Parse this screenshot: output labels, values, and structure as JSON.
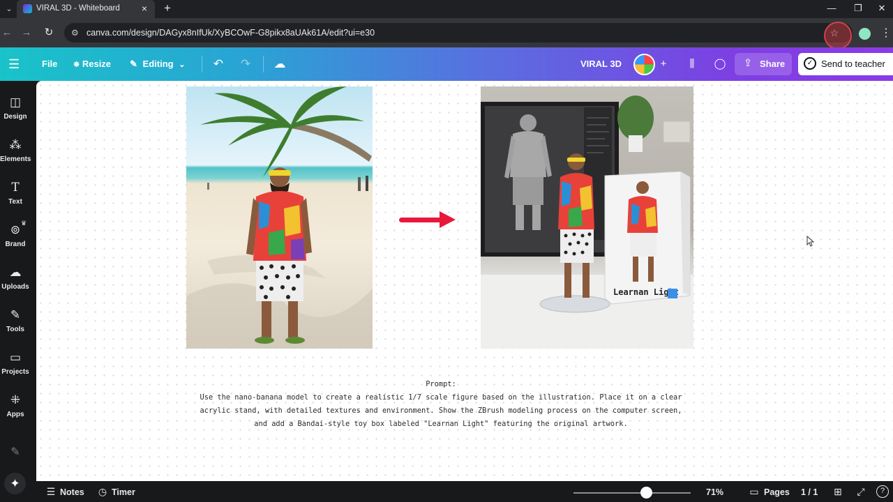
{
  "browser": {
    "tab_title": "VIRAL 3D - Whiteboard",
    "url": "canva.com/design/DAGyx8nIfUk/XyBCOwF-G8pikx8aUAk61A/edit?ui=e30"
  },
  "header": {
    "file": "File",
    "resize": "Resize",
    "editing": "Editing",
    "design_title": "VIRAL 3D",
    "share": "Share",
    "send_to_teacher": "Send to teacher"
  },
  "sidebar": {
    "items": [
      {
        "label": "Design",
        "icon": "design-icon"
      },
      {
        "label": "Elements",
        "icon": "elements-icon"
      },
      {
        "label": "Text",
        "icon": "text-icon"
      },
      {
        "label": "Brand",
        "icon": "brand-icon"
      },
      {
        "label": "Uploads",
        "icon": "uploads-icon"
      },
      {
        "label": "Tools",
        "icon": "tools-icon"
      },
      {
        "label": "Projects",
        "icon": "projects-icon"
      },
      {
        "label": "Apps",
        "icon": "apps-icon"
      }
    ]
  },
  "canvas": {
    "figure_box_label": "Learnan Light",
    "prompt_title": "Prompt:",
    "prompt_body": "Use the nano-banana model to create a realistic 1/7 scale figure based on the illustration. Place it on a clear acrylic stand, with detailed textures and environment. Show the ZBrush modeling process on the computer screen, and add a Bandai-style toy box labeled \"Learnan Light\" featuring the original artwork."
  },
  "bottom_bar": {
    "notes": "Notes",
    "timer": "Timer",
    "zoom": "71%",
    "zoom_level": 0.62,
    "pages": "Pages",
    "page_count": "1 / 1"
  },
  "colors": {
    "header_start": "#19c3c9",
    "header_end": "#8b3be6",
    "arrow": "#e8183a"
  }
}
